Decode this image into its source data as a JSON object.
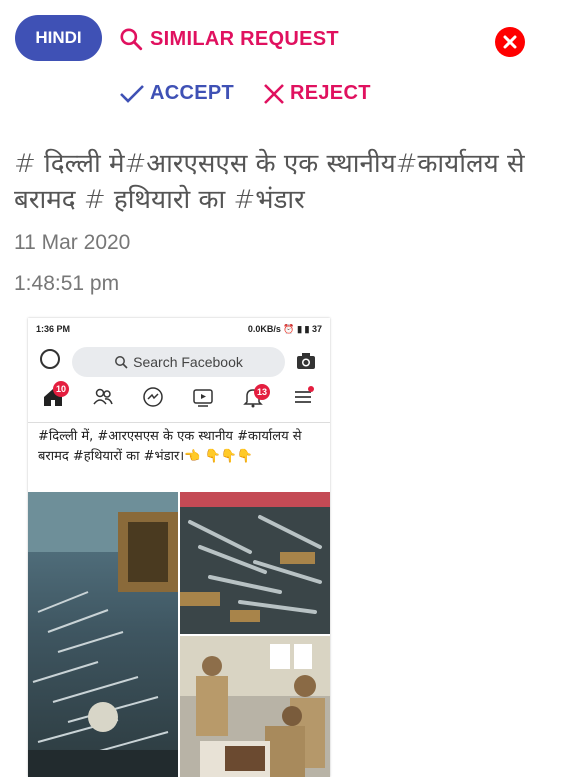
{
  "toolbar": {
    "language_label": "HINDI",
    "similar_label": "SIMILAR REQUEST",
    "accept_label": "ACCEPT",
    "reject_label": "REJECT"
  },
  "post": {
    "title": "# दिल्ली मे#आरएसएस के एक स्थानीय#कार्यालय से बरामद # हथियारो का #भंडार",
    "date": "11 Mar 2020",
    "time": "1:48:51 pm"
  },
  "screenshot": {
    "status_time": "1:36 PM",
    "status_right": "0.0KB/s ⏰ ▮ ▮ 37",
    "search_placeholder": "Search Facebook",
    "home_badge": "10",
    "notif_badge": "13",
    "post_text": "#दिल्ली में, #आरएसएस के एक स्थानीय #कार्यालय से बरामद #हथियारों का #भंडार।👈 👇👇👇"
  },
  "colors": {
    "accent_blue": "#3f51b5",
    "accent_pink": "#e0115f",
    "close_red": "#ff0000"
  }
}
